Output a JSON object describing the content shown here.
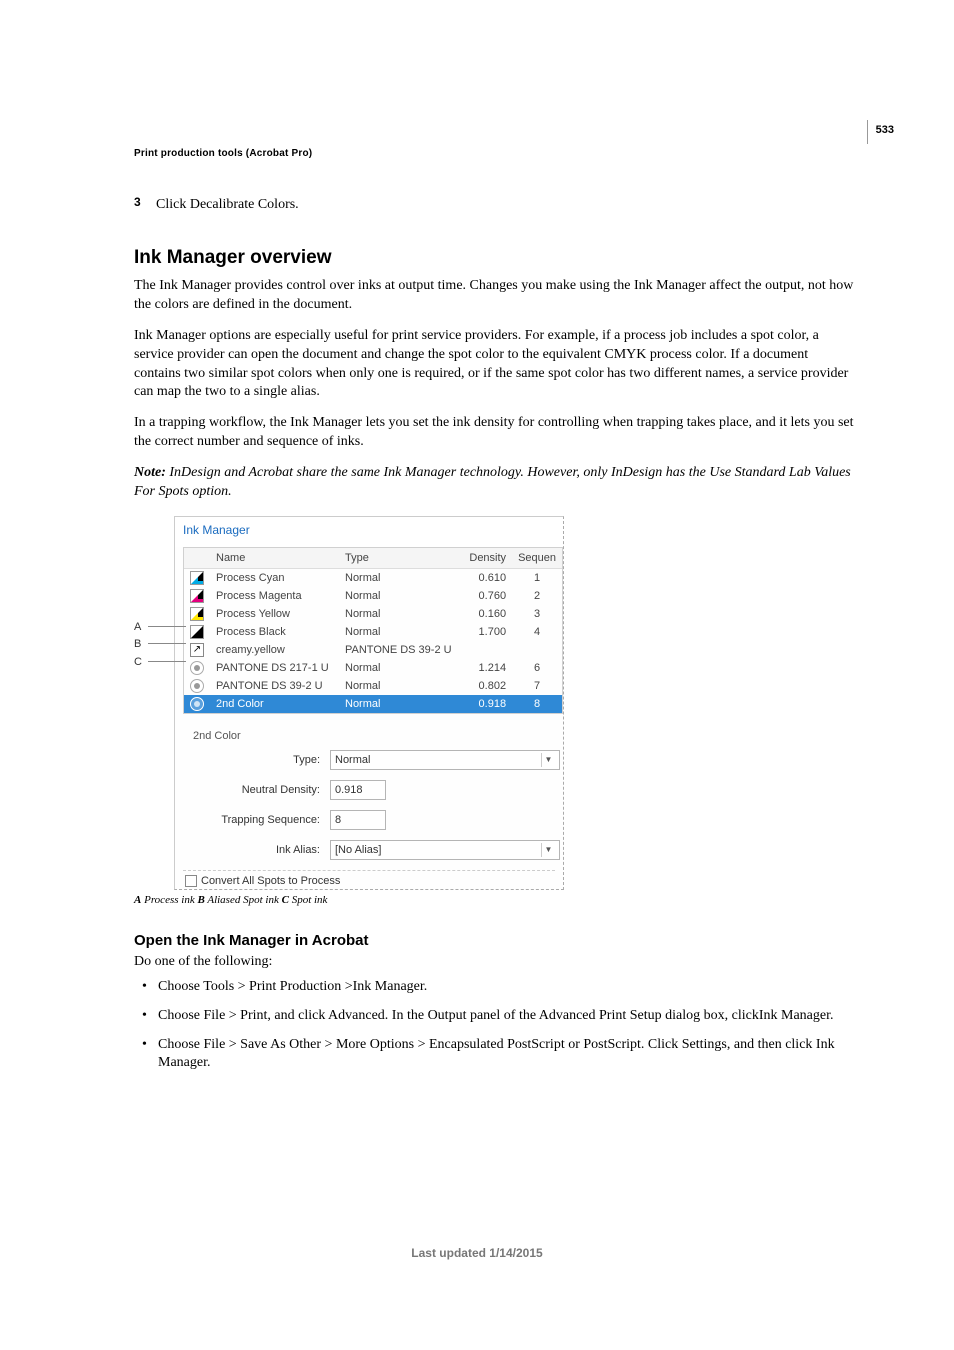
{
  "page_number": "533",
  "header": "Print production tools (Acrobat Pro)",
  "step3": {
    "num": "3",
    "text": "Click Decalibrate Colors."
  },
  "section_title": "Ink Manager overview",
  "para1": "The Ink Manager provides control over inks at output time. Changes you make using the Ink Manager affect the output, not how the colors are defined in the document.",
  "para2": "Ink Manager options are especially useful for print service providers. For example, if a process job includes a spot color, a service provider can open the document and change the spot color to the equivalent CMYK process color. If a document contains two similar spot colors when only one is required, or if the same spot color has two different names, a service provider can map the two to a single alias.",
  "para3": "In a trapping workflow, the Ink Manager lets you set the ink density for controlling when trapping takes place, and it lets you set the correct number and sequence of inks.",
  "note_label": "Note:",
  "note_text": " InDesign and Acrobat share the same Ink Manager technology. However, only InDesign has the Use Standard Lab Values For Spots option.",
  "dialog": {
    "title": "Ink Manager",
    "columns": {
      "name": "Name",
      "type": "Type",
      "density": "Density",
      "sequence": "Sequen"
    },
    "rows": [
      {
        "name": "Process Cyan",
        "type": "Normal",
        "density": "0.610",
        "seq": "1",
        "icon": "process-cyan"
      },
      {
        "name": "Process Magenta",
        "type": "Normal",
        "density": "0.760",
        "seq": "2",
        "icon": "process-magenta"
      },
      {
        "name": "Process Yellow",
        "type": "Normal",
        "density": "0.160",
        "seq": "3",
        "icon": "process-yellow"
      },
      {
        "name": "Process Black",
        "type": "Normal",
        "density": "1.700",
        "seq": "4",
        "icon": "process-black"
      },
      {
        "name": "creamy.yellow",
        "type": "PANTONE DS 39-2 U",
        "density": "",
        "seq": "",
        "icon": "alias"
      },
      {
        "name": "PANTONE DS 217-1 U",
        "type": "Normal",
        "density": "1.214",
        "seq": "6",
        "icon": "spot"
      },
      {
        "name": "PANTONE DS 39-2 U",
        "type": "Normal",
        "density": "0.802",
        "seq": "7",
        "icon": "spot"
      },
      {
        "name": "2nd Color",
        "type": "Normal",
        "density": "0.918",
        "seq": "8",
        "icon": "spot-sel",
        "selected": true
      }
    ],
    "group": "2nd Color",
    "type_label": "Type:",
    "type_value": "Normal",
    "density_label": "Neutral Density:",
    "density_value": "0.918",
    "seq_label": "Trapping Sequence:",
    "seq_value": "8",
    "alias_label": "Ink Alias:",
    "alias_value": "[No Alias]",
    "convert_label": "Convert All Spots to Process"
  },
  "callouts": {
    "A": "A",
    "B": "B",
    "C": "C"
  },
  "caption": {
    "a_lbl": "A",
    "a_txt": " Process ink ",
    "b_lbl": "B",
    "b_txt": " Aliased Spot ink ",
    "c_lbl": "C",
    "c_txt": " Spot ink"
  },
  "sub_title": "Open the Ink Manager in Acrobat",
  "sub_intro": "Do one of the following:",
  "bullets": [
    "Choose Tools > Print Production >Ink Manager.",
    "Choose File > Print, and click Advanced. In the Output panel of the Advanced Print Setup dialog box, clickInk Manager.",
    "Choose File > Save As Other > More Options > Encapsulated PostScript or PostScript. Click Settings, and then click Ink Manager."
  ],
  "footer": "Last updated 1/14/2015"
}
